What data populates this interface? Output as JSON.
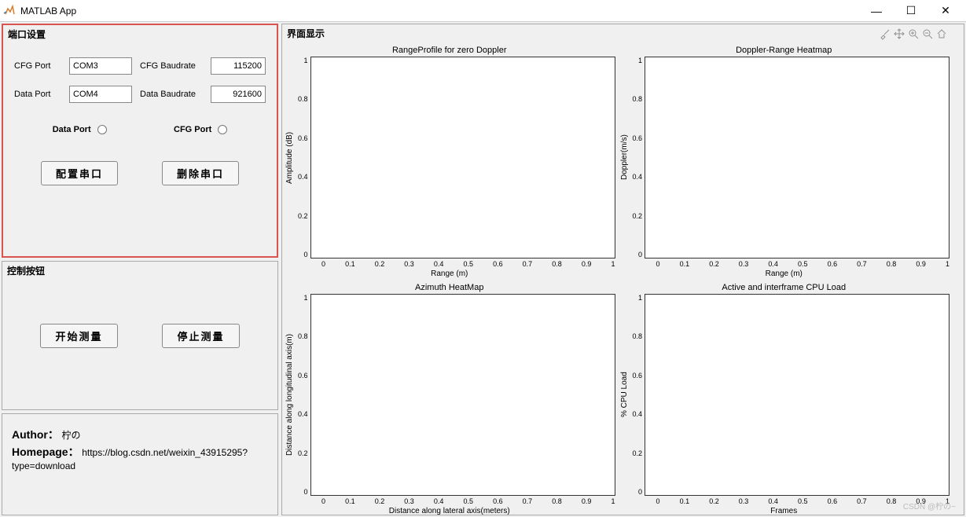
{
  "title": "MATLAB App",
  "win": {
    "min": "—",
    "max": "☐",
    "close": "✕"
  },
  "port_panel": {
    "title": "端口设置",
    "cfg_port_label": "CFG Port",
    "cfg_port_value": "COM3",
    "cfg_baud_label": "CFG Baudrate",
    "cfg_baud_value": "115200",
    "data_port_label": "Data Port",
    "data_port_value": "COM4",
    "data_baud_label": "Data Baudrate",
    "data_baud_value": "921600",
    "radio_data": "Data Port",
    "radio_cfg": "CFG Port",
    "btn_config": "配置串口",
    "btn_delete": "删除串口"
  },
  "ctrl_panel": {
    "title": "控制按钮",
    "btn_start": "开始测量",
    "btn_stop": "停止测量"
  },
  "info": {
    "author_label": "Author：",
    "author_value": "柠の",
    "homepage_label": "Homepage：",
    "homepage_value": "https://blog.csdn.net/weixin_43915295?type=download"
  },
  "display": {
    "title": "界面显示"
  },
  "chart_data": [
    {
      "type": "line",
      "title": "RangeProfile for zero Doppler",
      "xlabel": "Range (m)",
      "ylabel": "Amplitude (dB)",
      "xticks": [
        "0",
        "0.1",
        "0.2",
        "0.3",
        "0.4",
        "0.5",
        "0.6",
        "0.7",
        "0.8",
        "0.9",
        "1"
      ],
      "yticks": [
        "1",
        "0.8",
        "0.6",
        "0.4",
        "0.2",
        "0"
      ],
      "xlim": [
        0,
        1
      ],
      "ylim": [
        0,
        1
      ],
      "series": []
    },
    {
      "type": "heatmap",
      "title": "Doppler-Range Heatmap",
      "xlabel": "Range (m)",
      "ylabel": "Doppler(m/s)",
      "xticks": [
        "0",
        "0.1",
        "0.2",
        "0.3",
        "0.4",
        "0.5",
        "0.6",
        "0.7",
        "0.8",
        "0.9",
        "1"
      ],
      "yticks": [
        "1",
        "0.8",
        "0.6",
        "0.4",
        "0.2",
        "0"
      ],
      "xlim": [
        0,
        1
      ],
      "ylim": [
        0,
        1
      ],
      "series": []
    },
    {
      "type": "heatmap",
      "title": "Azimuth HeatMap",
      "xlabel": "Distance along lateral axis(meters)",
      "ylabel": "Distance along longitudinal axis(m)",
      "xticks": [
        "0",
        "0.1",
        "0.2",
        "0.3",
        "0.4",
        "0.5",
        "0.6",
        "0.7",
        "0.8",
        "0.9",
        "1"
      ],
      "yticks": [
        "1",
        "0.8",
        "0.6",
        "0.4",
        "0.2",
        "0"
      ],
      "xlim": [
        0,
        1
      ],
      "ylim": [
        0,
        1
      ],
      "series": []
    },
    {
      "type": "line",
      "title": "Active and interframe CPU Load",
      "xlabel": "Frames",
      "ylabel": "% CPU Load",
      "xticks": [
        "0",
        "0.1",
        "0.2",
        "0.3",
        "0.4",
        "0.5",
        "0.6",
        "0.7",
        "0.8",
        "0.9",
        "1"
      ],
      "yticks": [
        "1",
        "0.8",
        "0.6",
        "0.4",
        "0.2",
        "0"
      ],
      "xlim": [
        0,
        1
      ],
      "ylim": [
        0,
        1
      ],
      "series": []
    }
  ],
  "watermark": "CSDN @柠の~"
}
